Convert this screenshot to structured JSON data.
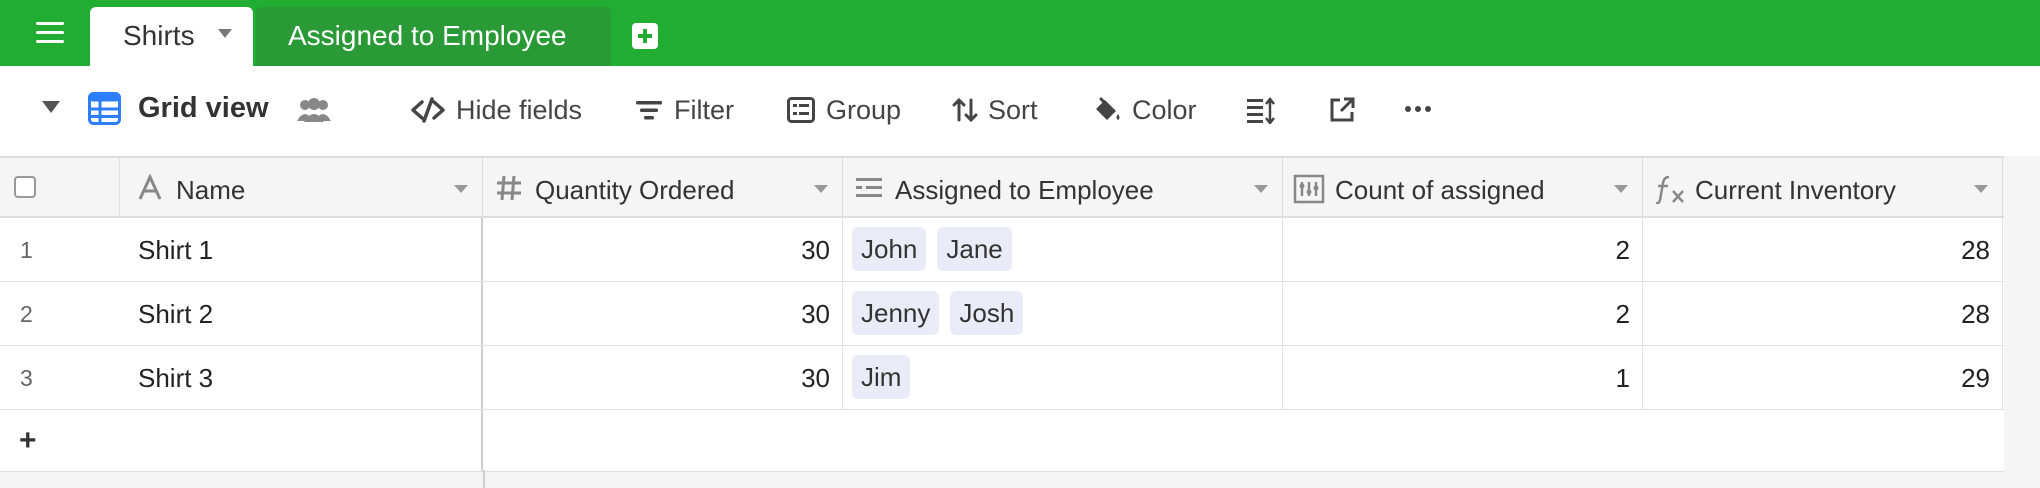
{
  "tabs": [
    {
      "label": "Shirts",
      "active": true
    },
    {
      "label": "Assigned to Employee",
      "active": false
    }
  ],
  "view": {
    "name": "Grid view"
  },
  "toolbar": {
    "hide_fields": "Hide fields",
    "filter": "Filter",
    "group": "Group",
    "sort": "Sort",
    "color": "Color"
  },
  "columns": [
    {
      "label": "Name",
      "icon": "text-a-icon"
    },
    {
      "label": "Quantity Ordered",
      "icon": "number-hash-icon"
    },
    {
      "label": "Assigned to Employee",
      "icon": "link-list-icon"
    },
    {
      "label": "Count of assigned",
      "icon": "count-icon"
    },
    {
      "label": "Current Inventory",
      "icon": "formula-fx-icon"
    }
  ],
  "rows": [
    {
      "num": "1",
      "name": "Shirt 1",
      "qty": "30",
      "employees": [
        "John",
        "Jane"
      ],
      "count": "2",
      "inventory": "28"
    },
    {
      "num": "2",
      "name": "Shirt 2",
      "qty": "30",
      "employees": [
        "Jenny",
        "Josh"
      ],
      "count": "2",
      "inventory": "28"
    },
    {
      "num": "3",
      "name": "Shirt 3",
      "qty": "30",
      "employees": [
        "Jim"
      ],
      "count": "1",
      "inventory": "29"
    }
  ],
  "add_row_label": "+",
  "colors": {
    "topbar": "#20ad32",
    "inactive_tab": "#2a9a37",
    "grid_view_icon": "#2d7ff9",
    "chip_bg": "#e9ecf6"
  }
}
